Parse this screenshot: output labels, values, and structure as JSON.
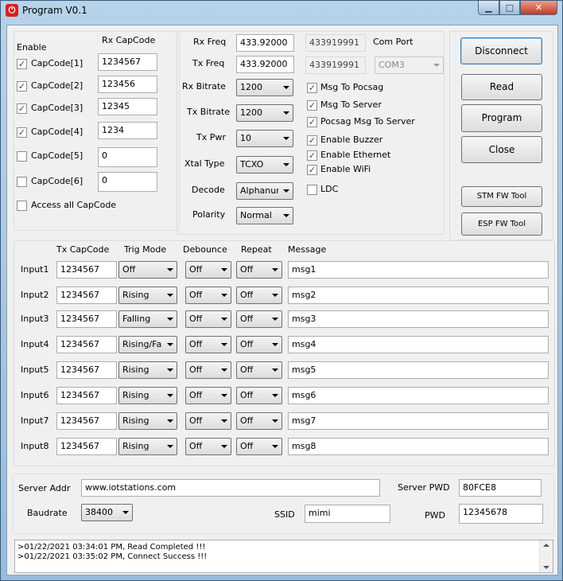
{
  "window": {
    "title": "Program V0.1",
    "app_icon": "power-icon",
    "min_glyph": "▁",
    "max_glyph": "□",
    "close_glyph": "✕"
  },
  "capcodes": {
    "enable_header": "Enable",
    "rx_header": "Rx CapCode",
    "items": [
      {
        "label": "CapCode[1]",
        "checked": true,
        "value": "1234567"
      },
      {
        "label": "CapCode[2]",
        "checked": true,
        "value": "123456"
      },
      {
        "label": "CapCode[3]",
        "checked": true,
        "value": "12345"
      },
      {
        "label": "CapCode[4]",
        "checked": true,
        "value": "1234"
      },
      {
        "label": "CapCode[5]",
        "checked": false,
        "value": "0"
      },
      {
        "label": "CapCode[6]",
        "checked": false,
        "value": "0"
      }
    ],
    "access_all": {
      "label": "Access all CapCode",
      "checked": false
    }
  },
  "radio": {
    "rx_freq_label": "Rx Freq",
    "rx_freq": "433.92000",
    "rx_freq_raw": "433919991",
    "tx_freq_label": "Tx Freq",
    "tx_freq": "433.92000",
    "tx_freq_raw": "433919991",
    "com_port_label": "Com Port",
    "com_port": "COM3",
    "rx_bitrate_label": "Rx Bitrate",
    "rx_bitrate": "1200",
    "tx_bitrate_label": "Tx Bitrate",
    "tx_bitrate": "1200",
    "tx_pwr_label": "Tx Pwr",
    "tx_pwr": "10",
    "xtal_label": "Xtal Type",
    "xtal": "TCXO",
    "decode_label": "Decode",
    "decode": "Alphanur",
    "polarity_label": "Polarity",
    "polarity": "Normal",
    "options": [
      {
        "label": "Msg To Pocsag",
        "checked": true
      },
      {
        "label": "Msg To Server",
        "checked": true
      },
      {
        "label": "Pocsag Msg To Server",
        "checked": true
      },
      {
        "label": "Enable Buzzer",
        "checked": true
      },
      {
        "label": "Enable Ethernet",
        "checked": true
      },
      {
        "label": "Enable WiFi",
        "checked": true
      },
      {
        "label": "LDC",
        "checked": false
      }
    ]
  },
  "buttons": {
    "disconnect": "Disconnect",
    "read": "Read",
    "program": "Program",
    "close": "Close",
    "stm": "STM FW Tool",
    "esp": "ESP FW Tool"
  },
  "inputs": {
    "headers": {
      "tx": "Tx CapCode",
      "trig": "Trig Mode",
      "debounce": "Debounce",
      "repeat": "Repeat",
      "message": "Message"
    },
    "rows": [
      {
        "label": "Input1",
        "tx": "1234567",
        "trig": "Off",
        "debounce": "Off",
        "repeat": "Off",
        "message": "msg1"
      },
      {
        "label": "Input2",
        "tx": "1234567",
        "trig": "Rising",
        "debounce": "Off",
        "repeat": "Off",
        "message": "msg2"
      },
      {
        "label": "Input3",
        "tx": "1234567",
        "trig": "Falling",
        "debounce": "Off",
        "repeat": "Off",
        "message": "msg3"
      },
      {
        "label": "Input4",
        "tx": "1234567",
        "trig": "Rising/Fa",
        "debounce": "Off",
        "repeat": "Off",
        "message": "msg4"
      },
      {
        "label": "Input5",
        "tx": "1234567",
        "trig": "Rising",
        "debounce": "Off",
        "repeat": "Off",
        "message": "msg5"
      },
      {
        "label": "Input6",
        "tx": "1234567",
        "trig": "Rising",
        "debounce": "Off",
        "repeat": "Off",
        "message": "msg6"
      },
      {
        "label": "Input7",
        "tx": "1234567",
        "trig": "Rising",
        "debounce": "Off",
        "repeat": "Off",
        "message": "msg7"
      },
      {
        "label": "Input8",
        "tx": "1234567",
        "trig": "Rising",
        "debounce": "Off",
        "repeat": "Off",
        "message": "msg8"
      }
    ]
  },
  "network": {
    "server_addr_label": "Server Addr",
    "server_addr": "www.iotstations.com",
    "server_pwd_label": "Server PWD",
    "server_pwd": "80FCE8",
    "baudrate_label": "Baudrate",
    "baudrate": "38400",
    "ssid_label": "SSID",
    "ssid": "mimi",
    "pwd_label": "PWD",
    "pwd": "12345678"
  },
  "log": [
    ">01/22/2021 03:34:01 PM,  Read Completed !!!",
    ">01/22/2021 03:35:02 PM,  Connect Success !!!"
  ],
  "colors": {
    "check_mark": "#2a4a7a",
    "close_button": "#c23a22"
  }
}
